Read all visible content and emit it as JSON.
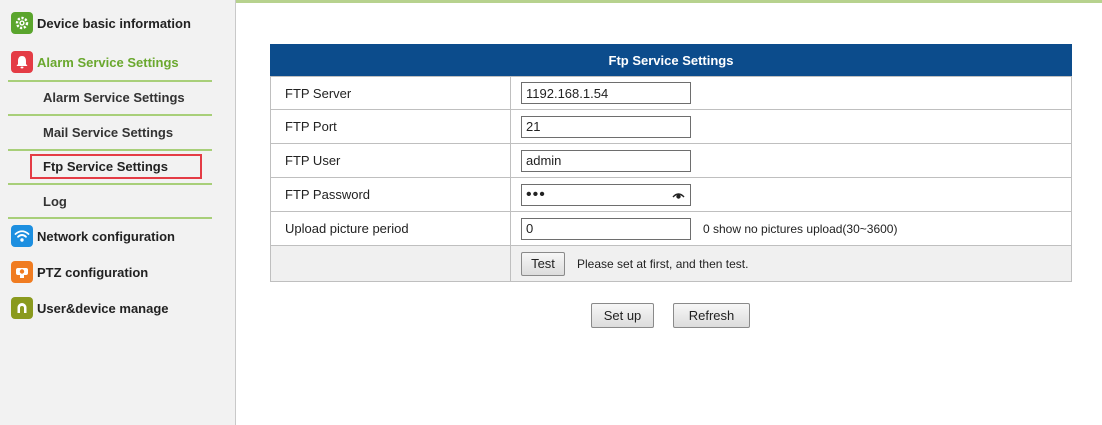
{
  "sidebar": {
    "categories": [
      {
        "label": "Device basic information",
        "icon": "gear-icon",
        "color": "#5aa52d"
      },
      {
        "label": "Alarm Service Settings",
        "icon": "bell-icon",
        "color": "#e43c45"
      },
      {
        "label": "Network configuration",
        "icon": "wifi-icon",
        "color": "#1d8fe0"
      },
      {
        "label": "PTZ configuration",
        "icon": "camera-icon",
        "color": "#f07c21"
      },
      {
        "label": "User&device manage",
        "icon": "user-icon",
        "color": "#8a9a1e"
      }
    ],
    "sub_items": [
      {
        "label": "Alarm Service Settings"
      },
      {
        "label": "Mail Service Settings"
      },
      {
        "label": "Ftp Service Settings"
      },
      {
        "label": "Log"
      }
    ],
    "selected_sub": "Ftp Service Settings",
    "active_category_color": "#6aa82e",
    "accent_separator_color": "#a8cf79",
    "selection_border_color": "#e43c45"
  },
  "panel": {
    "title": "Ftp Service Settings",
    "header_color": "#0c4c8c",
    "rows": [
      {
        "label": "FTP Server",
        "value": "1192.168.1.54"
      },
      {
        "label": "FTP Port",
        "value": "21"
      },
      {
        "label": "FTP User",
        "value": "admin"
      },
      {
        "label": "FTP Password",
        "value": "•••"
      },
      {
        "label": "Upload picture period",
        "value": "0",
        "hint": "0 show no pictures upload(30~3600)"
      }
    ],
    "test_button": "Test",
    "test_hint": "Please set at first, and then test."
  },
  "actions": {
    "setup_label": "Set up",
    "refresh_label": "Refresh"
  }
}
